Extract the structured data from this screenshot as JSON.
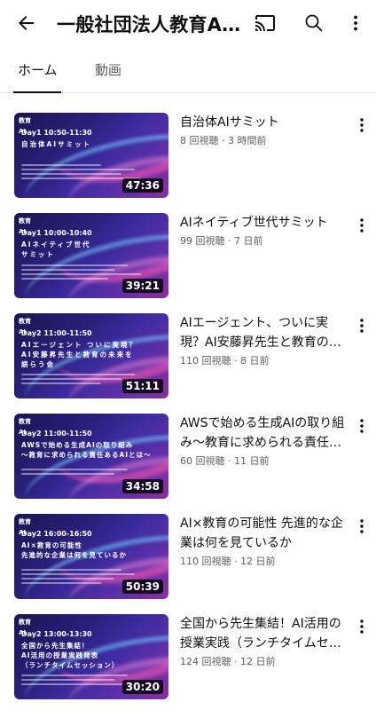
{
  "header": {
    "channel_title": "一般社団法人教育AI活用協会",
    "icons": [
      "back-arrow-icon",
      "cast-icon",
      "search-icon",
      "more-vert-icon"
    ]
  },
  "tabs": [
    {
      "label": "ホーム",
      "active": true
    },
    {
      "label": "動画",
      "active": false
    }
  ],
  "videos": [
    {
      "title": "自治体AIサミット",
      "stats": "8 回視聴 · 3 時間前",
      "duration": "47:36",
      "thumb_day": "Day1 10:50-11:30",
      "thumb_session": "自治体AIサミット"
    },
    {
      "title": "AIネイティブ世代サミット",
      "stats": "99 回視聴 · 7 日前",
      "duration": "39:21",
      "thumb_day": "Day1 10:00-10:40",
      "thumb_session": "AIネイティブ世代\nサミット"
    },
    {
      "title": "AIエージェント、ついに実現？AI安藤昇先生と教育の未来を語る会",
      "stats": "110 回視聴 · 8 日前",
      "duration": "51:11",
      "thumb_day": "Day2 11:00-11:50",
      "thumb_session": "AIエージェント ついに実現？\nAI安藤昇先生と教育の未来を\n語らう会"
    },
    {
      "title": "AWSで始める生成AIの取り組み～教育に求められる責任あるAIとは",
      "stats": "60 回視聴 · 11 日前",
      "duration": "34:58",
      "thumb_day": "Day2 11:00-11:50",
      "thumb_session": "AWSで始める生成AIの取り組み\n～教育に求められる責任あるAIとは～"
    },
    {
      "title": "AI×教育の可能性 先進的な企業は何を見ているか",
      "stats": "110 回視聴 · 12 日前",
      "duration": "50:39",
      "thumb_day": "Day2 16:00-16:50",
      "thumb_session": "AI×教育の可能性\n先進的な企業は何を見ているか"
    },
    {
      "title": "全国から先生集結！AI活用の授業実践（ランチタイムセッション）",
      "stats": "124 回視聴 · 12 日前",
      "duration": "30:20",
      "thumb_day": "Day2 13:00-13:30",
      "thumb_session": "全国から先生集結！\nAI活用の授業実践発表\n（ランチタイムセッション）"
    }
  ],
  "thumb_logo": "教育AI"
}
